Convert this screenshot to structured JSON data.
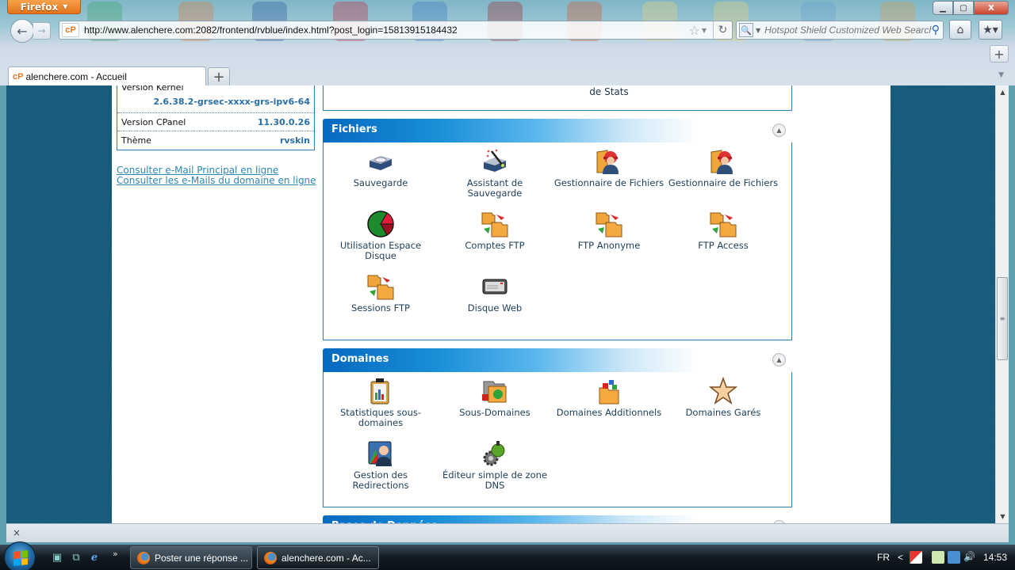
{
  "browser": {
    "app_button": "Firefox",
    "url": "http://www.alenchere.com:2082/frontend/rvblue/index.html?post_login=15813915184432",
    "site_badge": "cP",
    "search_placeholder": "Hotspot Shield Customized Web Search",
    "tabs": [
      {
        "label": "alenchere.com - Accueil",
        "active": true
      }
    ],
    "new_tab_symbol": "+",
    "window_controls": {
      "minimize": "▁",
      "maximize": "▢",
      "close": "X"
    }
  },
  "server_info": {
    "rows": [
      {
        "label": "Version Kernel",
        "value": "2.6.38.2-grsec-xxxx-grs-ipv6-64"
      },
      {
        "label": "Version CPanel",
        "value": "11.30.0.26"
      },
      {
        "label": "Thème",
        "value": "rvskin"
      }
    ]
  },
  "webmail_links": [
    "Consulter e-Mail Principal en ligne",
    "Consulter les e-Mails du domaine en ligne"
  ],
  "stats_section_tail": "de Stats",
  "sections": [
    {
      "title": "Fichiers",
      "items": [
        {
          "label": "Sauvegarde",
          "icon": "backup-drive-icon"
        },
        {
          "label": "Assistant de Sauvegarde",
          "icon": "backup-wizard-icon"
        },
        {
          "label": "Gestionnaire de Fichiers",
          "icon": "file-manager-icon"
        },
        {
          "label": "Gestionnaire de Fichiers",
          "icon": "file-manager-icon"
        },
        {
          "label": "Utilisation Espace Disque",
          "icon": "disk-usage-pie-icon"
        },
        {
          "label": "Comptes FTP",
          "icon": "ftp-folders-icon"
        },
        {
          "label": "FTP Anonyme",
          "icon": "ftp-folders-icon"
        },
        {
          "label": "FTP Access",
          "icon": "ftp-folders-icon"
        },
        {
          "label": "Sessions FTP",
          "icon": "ftp-folders-icon"
        },
        {
          "label": "Disque Web",
          "icon": "web-disk-icon"
        }
      ]
    },
    {
      "title": "Domaines",
      "items": [
        {
          "label": "Statistiques sous-domaines",
          "icon": "subdomain-stats-icon"
        },
        {
          "label": "Sous-Domaines",
          "icon": "subdomains-folder-icon"
        },
        {
          "label": "Domaines Additionnels",
          "icon": "addon-domains-icon"
        },
        {
          "label": "Domaines Garés",
          "icon": "parked-domains-star-icon"
        },
        {
          "label": "Gestion des Redirections",
          "icon": "redirects-person-icon"
        },
        {
          "label": "Éditeur simple de zone DNS",
          "icon": "dns-zone-gear-icon"
        }
      ]
    },
    {
      "title": "Bases de Données",
      "items": []
    }
  ],
  "statusbar": {
    "close_symbol": "×"
  },
  "taskbar": {
    "windows": [
      {
        "label": "Poster une réponse ...",
        "active": false
      },
      {
        "label": "alenchere.com - Ac...",
        "active": true
      }
    ],
    "overflow": "»",
    "language": "FR",
    "tray_expand": "<",
    "clock": "14:53"
  },
  "colors": {
    "section_header_start": "#0569c0",
    "section_border": "#2a7eb0",
    "page_background": "#155a7a",
    "link": "#2e86b3",
    "value_text": "#2a6fa1"
  }
}
